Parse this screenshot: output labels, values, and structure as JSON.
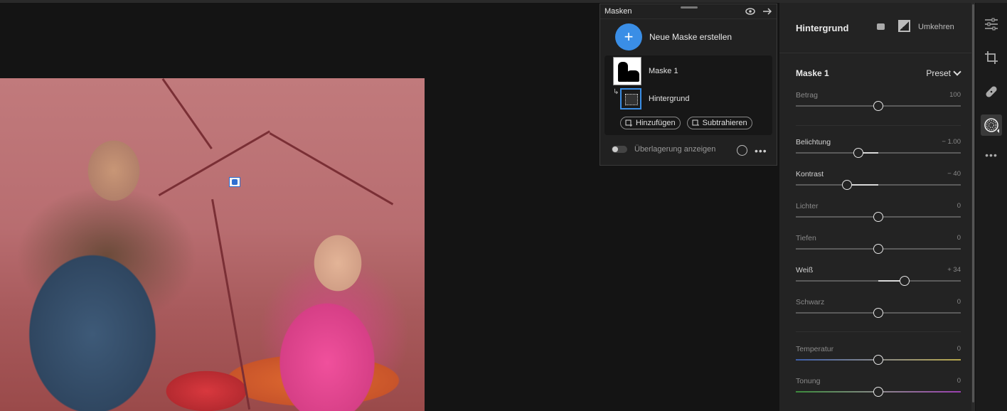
{
  "masks_panel": {
    "title": "Masken",
    "new_mask_label": "Neue Maske erstellen",
    "mask1_name": "Maske 1",
    "submask_name": "Hintergrund",
    "add_label": "Hinzufügen",
    "subtract_label": "Subtrahieren",
    "overlay_label": "Überlagerung anzeigen"
  },
  "right_panel": {
    "header_title": "Hintergrund",
    "invert_label": "Umkehren",
    "mask_title": "Maske 1",
    "preset_label": "Preset",
    "sliders": [
      {
        "label": "Betrag",
        "value": "100",
        "pos": 0.5
      },
      {
        "label": "Belichtung",
        "value": "− 1.00",
        "pos": 0.38
      },
      {
        "label": "Kontrast",
        "value": "− 40",
        "pos": 0.31
      },
      {
        "label": "Lichter",
        "value": "0",
        "pos": 0.5
      },
      {
        "label": "Tiefen",
        "value": "0",
        "pos": 0.5
      },
      {
        "label": "Weiß",
        "value": "+ 34",
        "pos": 0.66
      },
      {
        "label": "Schwarz",
        "value": "0",
        "pos": 0.5
      },
      {
        "label": "Temperatur",
        "value": "0",
        "pos": 0.5
      },
      {
        "label": "Tonung",
        "value": "0",
        "pos": 0.5
      }
    ]
  },
  "colors": {
    "accent": "#3a8ee6",
    "mask_overlay": "#c17a7c"
  },
  "toolbar_icons": [
    "sliders-icon",
    "crop-icon",
    "healing-icon",
    "masking-icon",
    "more-icon"
  ]
}
